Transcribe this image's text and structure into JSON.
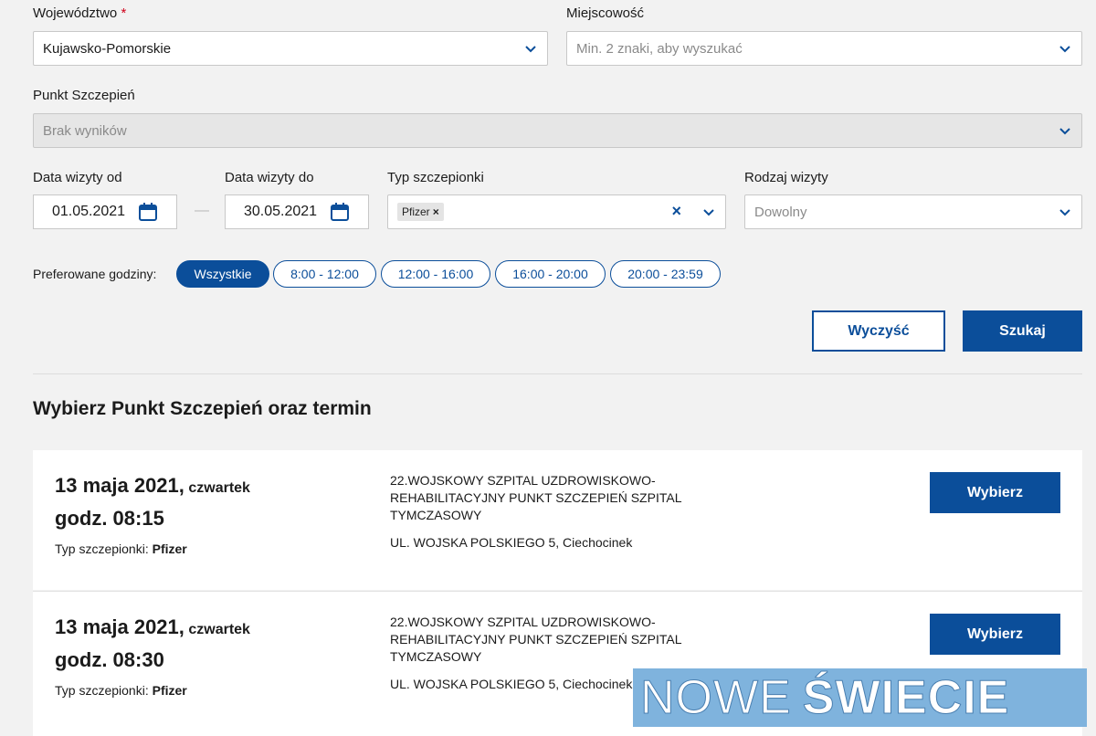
{
  "filters": {
    "voivodeship": {
      "label": "Województwo",
      "required_mark": "*",
      "value": "Kujawsko-Pomorskie"
    },
    "city": {
      "label": "Miejscowość",
      "placeholder": "Min. 2 znaki, aby wyszukać"
    },
    "point": {
      "label": "Punkt Szczepień",
      "value": "Brak wyników"
    },
    "date_from": {
      "label": "Data wizyty od",
      "value": "01.05.2021"
    },
    "date_to": {
      "label": "Data wizyty do",
      "value": "30.05.2021"
    },
    "date_separator": "—",
    "vaccine_type": {
      "label": "Typ szczepionki",
      "tag": "Pfizer",
      "tag_remove": "×",
      "clear": "×"
    },
    "visit_kind": {
      "label": "Rodzaj wizyty",
      "placeholder": "Dowolny"
    }
  },
  "hours": {
    "label": "Preferowane godziny:",
    "options": [
      "Wszystkie",
      "8:00 - 12:00",
      "12:00 - 16:00",
      "16:00 - 20:00",
      "20:00 - 23:59"
    ],
    "selected": "Wszystkie"
  },
  "actions": {
    "clear": "Wyczyść",
    "search": "Szukaj"
  },
  "results": {
    "title": "Wybierz Punkt Szczepień oraz termin",
    "items": [
      {
        "date": "13 maja 2021,",
        "day": "czwartek",
        "time": "godz. 08:15",
        "type_label": "Typ szczepionki:",
        "type_value": "Pfizer",
        "place": "22.WOJSKOWY SZPITAL UZDROWISKOWO-REHABILITACYJNY PUNKT SZCZEPIEŃ SZPITAL TYMCZASOWY",
        "address": "UL. WOJSKA POLSKIEGO 5, Ciechocinek",
        "button": "Wybierz"
      },
      {
        "date": "13 maja 2021,",
        "day": "czwartek",
        "time": "godz. 08:30",
        "type_label": "Typ szczepionki:",
        "type_value": "Pfizer",
        "place": "22.WOJSKOWY SZPITAL UZDROWISKOWO-REHABILITACYJNY PUNKT SZCZEPIEŃ SZPITAL TYMCZASOWY",
        "address": "UL. WOJSKA POLSKIEGO 5, Ciechocinek",
        "button": "Wybierz"
      }
    ]
  },
  "watermark": {
    "light": "NOWE",
    "bold": "ŚWIECIE"
  },
  "colors": {
    "primary": "#0b4e9a",
    "background": "#f2f2f2",
    "required": "#d0021b",
    "watermark_bg": "#7fb3dd"
  }
}
